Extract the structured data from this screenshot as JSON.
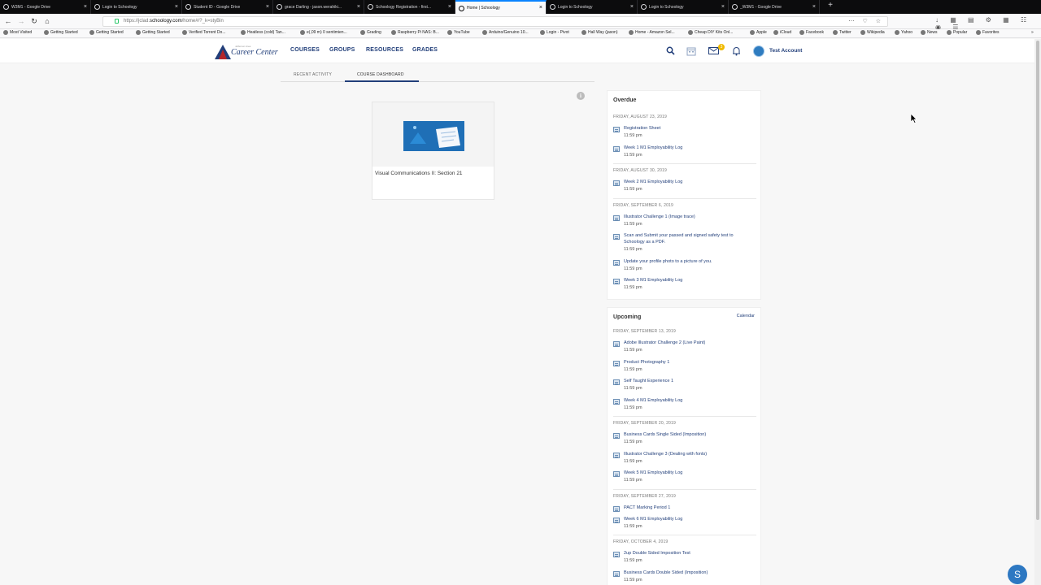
{
  "browser": {
    "tabs": [
      {
        "title": "W3M1 - Google Drive",
        "active": false
      },
      {
        "title": "Login to Schoology",
        "active": false
      },
      {
        "title": "Student ID - Google Drive",
        "active": false
      },
      {
        "title": "grace Darling - jason.werahiki...",
        "active": false
      },
      {
        "title": "Schoology Registration - first...",
        "active": false
      },
      {
        "title": "Home | Schoology",
        "active": true
      },
      {
        "title": "Login to Schoology",
        "active": false
      },
      {
        "title": "Login to Schoology",
        "active": false
      },
      {
        "title": "_W3M1 - Google Drive",
        "active": false
      }
    ],
    "url_prefix": "https://jclad.",
    "url_host": "schoology.com",
    "url_path": "/home#/?_k=styBin",
    "bookmarks": [
      "Most Visited",
      "Getting Started",
      "Getting Started",
      "Getting Started",
      "Verified Torrent Do...",
      "Heatless (cold) Tan...",
      "e(,09 m) 0 sentimien...",
      "Grading",
      "Raspberry Pi NAS: B...",
      "YouTube",
      "Arduino/Genuino 10...",
      "Login - Pivot",
      "Hall Way (jason)",
      "Home - Amazon Sel...",
      "Cheap DIY Kits Onl...",
      "Apple",
      "iCloud",
      "Facebook",
      "Twitter",
      "Wikipedia",
      "Yahoo",
      "News",
      "Popular",
      "Favorites"
    ]
  },
  "header": {
    "logo_small": "Jefferson Area",
    "logo_text": "Career Center",
    "nav": [
      "COURSES",
      "GROUPS",
      "RESOURCES",
      "GRADES"
    ],
    "message_count": "3",
    "account_name": "Test Account"
  },
  "subtabs": {
    "recent": "RECENT ACTIVITY",
    "dashboard": "COURSE DASHBOARD"
  },
  "course": {
    "title": "Visual Communications II: Section 21"
  },
  "overdue": {
    "title": "Overdue",
    "groups": [
      {
        "date": "FRIDAY, AUGUST 23, 2019",
        "items": [
          {
            "name": "Registration Sheet",
            "time": "11:59 pm"
          },
          {
            "name": "Week 1 M1 Employability Log",
            "time": "11:59 pm"
          }
        ]
      },
      {
        "date": "FRIDAY, AUGUST 30, 2019",
        "items": [
          {
            "name": "Week 2 M1 Employability Log",
            "time": "11:59 pm"
          }
        ]
      },
      {
        "date": "FRIDAY, SEPTEMBER 6, 2019",
        "items": [
          {
            "name": "Illustrator Challenge 1 (Image trace)",
            "time": "11:59 pm"
          },
          {
            "name": "Scan and Submit your passed and signed safety test to Schoology as a PDF.",
            "time": "11:59 pm"
          },
          {
            "name": "Update your profile photo to a picture of you.",
            "time": "11:59 pm"
          },
          {
            "name": "Week 3 M1 Employability Log",
            "time": "11:59 pm"
          }
        ]
      }
    ]
  },
  "upcoming": {
    "title": "Upcoming",
    "calendar_link": "Calendar",
    "groups": [
      {
        "date": "FRIDAY, SEPTEMBER 13, 2019",
        "items": [
          {
            "name": "Adobe Illustrator Challenge 2 (Live Paint)",
            "time": "11:59 pm"
          },
          {
            "name": "Product Photography 1",
            "time": "11:59 pm"
          },
          {
            "name": "Self Taught Experience 1",
            "time": "11:59 pm"
          },
          {
            "name": "Week 4 M1 Employability Log",
            "time": "11:59 pm"
          }
        ]
      },
      {
        "date": "FRIDAY, SEPTEMBER 20, 2019",
        "items": [
          {
            "name": "Business Cards Single Sided (Imposition)",
            "time": "11:59 pm"
          },
          {
            "name": "Illustrator Challenge 3 (Dealing with fonts)",
            "time": "11:59 pm"
          },
          {
            "name": "Week 5 M1 Employability Log",
            "time": "11:59 pm"
          }
        ]
      },
      {
        "date": "FRIDAY, SEPTEMBER 27, 2019",
        "items": [
          {
            "name": "PACT Marking Period 1",
            "time": ""
          },
          {
            "name": "Week 6 M1 Employability Log",
            "time": "11:59 pm"
          }
        ]
      },
      {
        "date": "FRIDAY, OCTOBER 4, 2019",
        "items": [
          {
            "name": "2up Double Sided Imposition Test",
            "time": "11:59 pm"
          },
          {
            "name": "Business Cards Double Sided (Imposition)",
            "time": "11:59 pm"
          }
        ]
      }
    ]
  },
  "chat_label": "S",
  "colors": {
    "brand": "#223f7a",
    "accent": "#2d78c2",
    "badge": "#f0ba00"
  }
}
